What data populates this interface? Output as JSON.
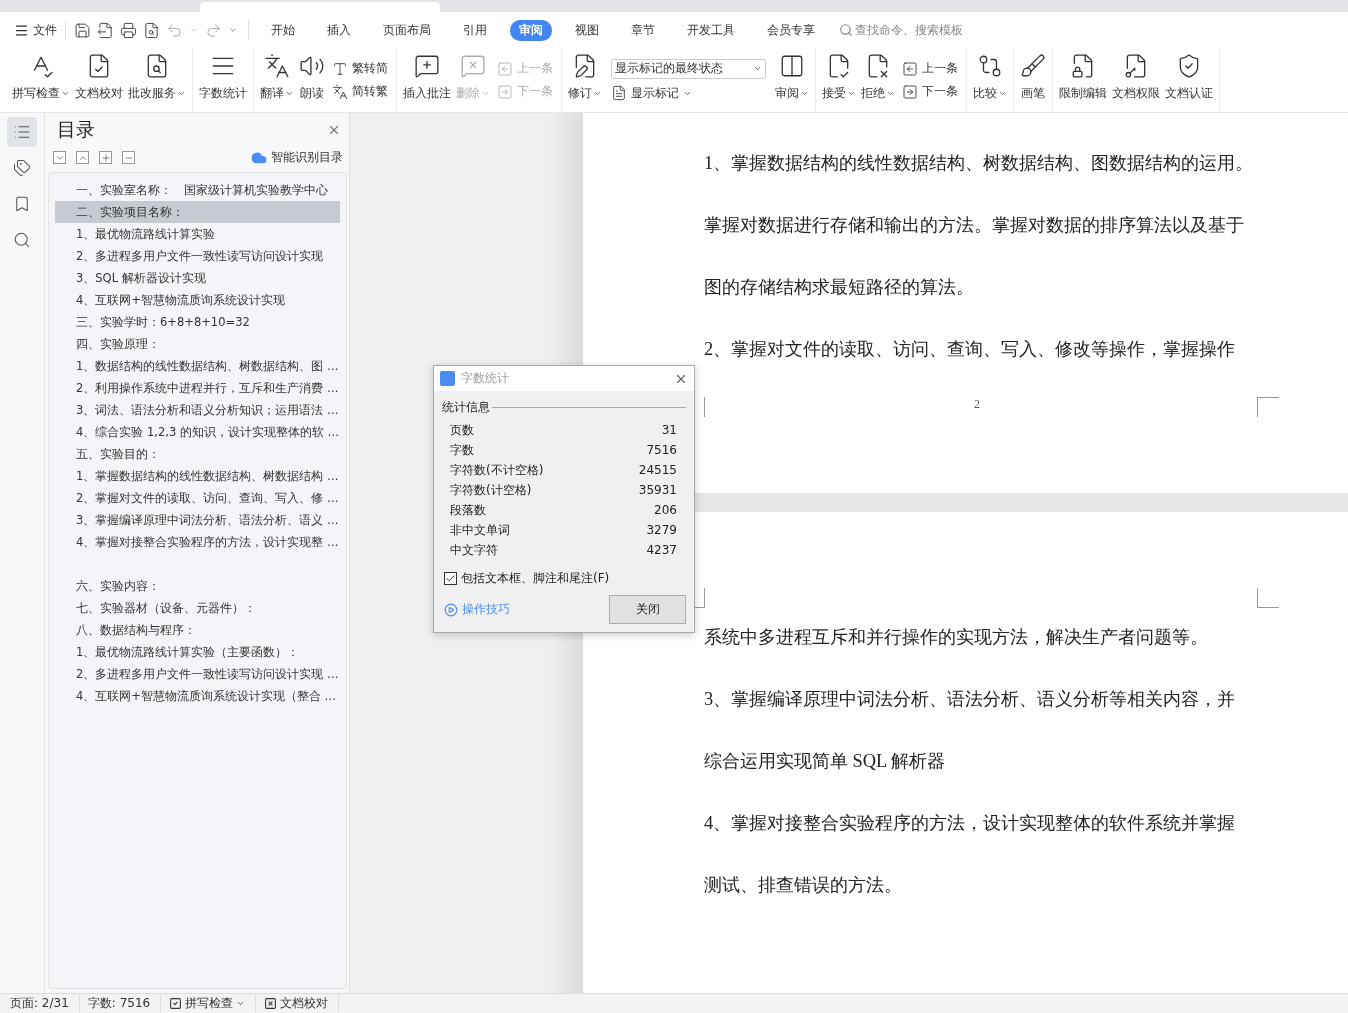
{
  "menu": {
    "file": "文件",
    "tabs": [
      {
        "label": "开始",
        "selected": false
      },
      {
        "label": "插入",
        "selected": false
      },
      {
        "label": "页面布局",
        "selected": false
      },
      {
        "label": "引用",
        "selected": false
      },
      {
        "label": "审阅",
        "selected": true
      },
      {
        "label": "视图",
        "selected": false
      },
      {
        "label": "章节",
        "selected": false
      },
      {
        "label": "开发工具",
        "selected": false
      },
      {
        "label": "会员专享",
        "selected": false
      }
    ],
    "search": {
      "placeholder": "查找命令、搜索模板"
    }
  },
  "ribbon": [
    [
      {
        "kind": "large",
        "label": "拼写检查",
        "dropdown": true,
        "disabled": false
      },
      {
        "kind": "large",
        "label": "文档校对",
        "disabled": false
      },
      {
        "kind": "large",
        "label": "批改服务",
        "dropdown": true,
        "disabled": false
      }
    ],
    [
      {
        "kind": "large",
        "label": "字数统计",
        "disabled": false
      }
    ],
    [
      {
        "kind": "large",
        "label": "翻译",
        "dropdown": true,
        "disabled": false
      },
      {
        "kind": "large",
        "label": "朗读",
        "disabled": false
      },
      {
        "kind": "pair",
        "rows": [
          {
            "label": "繁转简",
            "disabled": false
          },
          {
            "label": "简转繁",
            "disabled": false
          }
        ]
      }
    ],
    [
      {
        "kind": "large",
        "label": "插入批注",
        "disabled": false
      },
      {
        "kind": "large",
        "label": "删除",
        "dropdown": true,
        "disabled": true
      },
      {
        "kind": "pair",
        "rows": [
          {
            "label": "上一条",
            "disabled": true
          },
          {
            "label": "下一条",
            "disabled": true
          }
        ]
      }
    ],
    [
      {
        "kind": "large",
        "label": "修订",
        "dropdown": true,
        "disabled": false
      },
      {
        "kind": "display",
        "value": "显示标记的最终状态",
        "label": "显示标记",
        "dropdown": true
      },
      {
        "kind": "large",
        "label": "审阅",
        "dropdown": true,
        "disabled": false
      }
    ],
    [
      {
        "kind": "large",
        "label": "接受",
        "dropdown": true,
        "disabled": false
      },
      {
        "kind": "large",
        "label": "拒绝",
        "dropdown": true,
        "disabled": false
      },
      {
        "kind": "pair",
        "rows": [
          {
            "label": "上一条",
            "disabled": false
          },
          {
            "label": "下一条",
            "disabled": false
          }
        ]
      }
    ],
    [
      {
        "kind": "large",
        "label": "比较",
        "dropdown": true,
        "disabled": false
      }
    ],
    [
      {
        "kind": "large",
        "label": "画笔",
        "disabled": false
      }
    ],
    [
      {
        "kind": "large",
        "label": "限制编辑",
        "disabled": false
      },
      {
        "kind": "large",
        "label": "文档权限",
        "disabled": false
      },
      {
        "kind": "large",
        "label": "文档认证",
        "disabled": false
      }
    ]
  ],
  "toc": {
    "title": "目录",
    "smart_button": "智能识别目录",
    "items": [
      {
        "text": "一、实验室名称：　国家级计算机实验教学中心",
        "selected": false
      },
      {
        "text": "二、实验项目名称：",
        "selected": true
      },
      {
        "text": "1、最优物流路线计算实验",
        "selected": false
      },
      {
        "text": "2、多进程多用户文件一致性读写访问设计实现",
        "selected": false
      },
      {
        "text": "3、SQL 解析器设计实现",
        "selected": false
      },
      {
        "text": "4、互联网+智慧物流质询系统设计实现",
        "selected": false
      },
      {
        "text": "三、实验学时：6+8+8+10=32",
        "selected": false
      },
      {
        "text": "四、实验原理：",
        "selected": false
      },
      {
        "text": "1、数据结构的线性数据结构、树数据结构、图 …",
        "selected": false
      },
      {
        "text": "2、利用操作系统中进程并行，互斥和生产消费 …",
        "selected": false
      },
      {
        "text": "3、词法、语法分析和语义分析知识；运用语法 …",
        "selected": false
      },
      {
        "text": "4、综合实验 1,2,3 的知识，设计实现整体的软 …",
        "selected": false
      },
      {
        "text": "五、实验目的：",
        "selected": false
      },
      {
        "text": "1、掌握数据结构的线性数据结构、树数据结构 …",
        "selected": false
      },
      {
        "text": "2、掌握对文件的读取、访问、查询、写入、修 …",
        "selected": false
      },
      {
        "text": "3、掌握编译原理中词法分析、语法分析、语义 …",
        "selected": false
      },
      {
        "text": "4、掌握对接整合实验程序的方法，设计实现整 …",
        "selected": false
      },
      {
        "text": "六、实验内容：",
        "selected": false,
        "gap_before": true
      },
      {
        "text": "七、实验器材（设备、元器件）：",
        "selected": false
      },
      {
        "text": "八、数据结构与程序：",
        "selected": false
      },
      {
        "text": "1、最优物流路线计算实验（主要函数）：",
        "selected": false
      },
      {
        "text": "2、多进程多用户文件一致性读写访问设计实现 …",
        "selected": false
      },
      {
        "text": "4、互联网+智慧物流质询系统设计实现（整合 …",
        "selected": false
      }
    ]
  },
  "document": {
    "pages": [
      {
        "lines": [
          "1、掌握数据结构的线性数据结构、树数据结构、图数据结构的运用。",
          "掌握对数据进行存储和输出的方法。掌握对数据的排序算法以及基于",
          "图的存储结构求最短路径的算法。",
          "2、掌握对文件的读取、访问、查询、写入、修改等操作，掌握操作"
        ],
        "page_number": "2"
      },
      {
        "lines": [
          "系统中多进程互斥和并行操作的实现方法，解决生产者问题等。",
          "3、掌握编译原理中词法分析、语法分析、语义分析等相关内容，并",
          "综合运用实现简单 SQL 解析器",
          "4、掌握对接整合实验程序的方法，设计实现整体的软件系统并掌握",
          "测试、排查错误的方法。"
        ]
      }
    ]
  },
  "dialog": {
    "title": "字数统计",
    "section": "统计信息",
    "rows": [
      {
        "label": "页数",
        "value": "31"
      },
      {
        "label": "字数",
        "value": "7516"
      },
      {
        "label": "字符数(不计空格)",
        "value": "24515"
      },
      {
        "label": "字符数(计空格)",
        "value": "35931"
      },
      {
        "label": "段落数",
        "value": "206"
      },
      {
        "label": "非中文单词",
        "value": "3279"
      },
      {
        "label": "中文字符",
        "value": "4237"
      }
    ],
    "checkbox": {
      "label": "包括文本框、脚注和尾注(F)",
      "checked": true
    },
    "tips_link": "操作技巧",
    "close_button": "关闭"
  },
  "status_bar": {
    "page": "页面: 2/31",
    "words": "字数: 7516",
    "spell_check": "拼写检查",
    "proofread": "文档校对"
  }
}
